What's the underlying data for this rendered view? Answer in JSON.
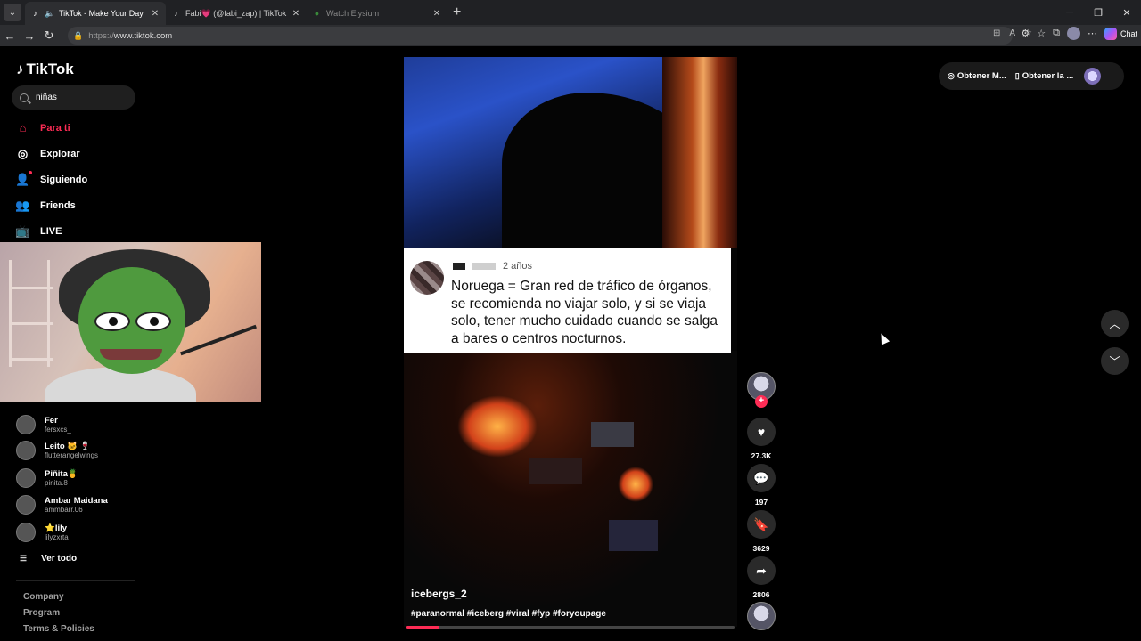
{
  "browser": {
    "tabs": [
      {
        "title": "TikTok - Make Your Day",
        "active": true,
        "icon": "tiktok-icon"
      },
      {
        "title": "Fabi💗 (@fabi_zap) | TikTok",
        "active": false,
        "icon": "tiktok-icon"
      },
      {
        "title": "Watch Elysium",
        "active": false,
        "icon": "globe-icon"
      }
    ],
    "url_prefix": "https://",
    "url_host": "www.tiktok.com",
    "chat_label": "Chat"
  },
  "sidebar": {
    "logo": "TikTok",
    "search_value": "niñas",
    "nav": [
      {
        "label": "Para ti",
        "icon": "home-icon",
        "active": true
      },
      {
        "label": "Explorar",
        "icon": "compass-icon",
        "active": false
      },
      {
        "label": "Siguiendo",
        "icon": "following-icon",
        "active": false
      },
      {
        "label": "Friends",
        "icon": "friends-icon",
        "active": false
      },
      {
        "label": "LIVE",
        "icon": "live-icon",
        "active": false
      }
    ],
    "accounts": [
      {
        "name": "Fer",
        "user": "fersxcs_"
      },
      {
        "name": "Leito 🐱 🍷",
        "user": "flutterangelwings"
      },
      {
        "name": "Piñita🍍",
        "user": "pinita.8"
      },
      {
        "name": "Ambar Maidana",
        "user": "ammbarr.06"
      },
      {
        "name": "⭐lily",
        "user": "lilyzxrta"
      }
    ],
    "see_all": "Ver todo",
    "footer": [
      "Company",
      "Program",
      "Terms & Policies"
    ]
  },
  "video": {
    "comment": {
      "time": "2 años",
      "text": "Noruega = Gran red de tráfico de órganos, se recomienda no viajar solo, y si se viaja solo, tener mucho cuidado cuando se salga a bares o centros nocturnos."
    },
    "author": "icebergs_2",
    "hashtags": "#paranormal #iceberg #viral #fyp #foryoupage",
    "progress": 0.1
  },
  "actions": {
    "likes": "27.3K",
    "comments": "197",
    "saves": "3629",
    "shares": "2806"
  },
  "topbar": {
    "btn1": "Obtener M...",
    "btn2": "Obtener la ..."
  },
  "colors": {
    "accent": "#fe2c55"
  }
}
